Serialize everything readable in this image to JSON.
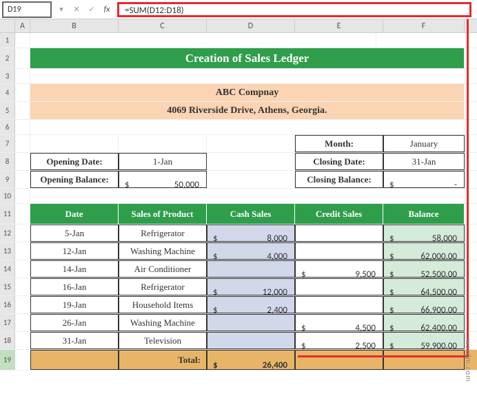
{
  "name_box": "D19",
  "formula": "=SUM(D12:D18)",
  "cols": {
    "A": "A",
    "B": "B",
    "C": "C",
    "D": "D",
    "E": "E",
    "F": "F"
  },
  "rows": [
    "1",
    "2",
    "3",
    "4",
    "5",
    "6",
    "7",
    "8",
    "9",
    "10",
    "11",
    "12",
    "13",
    "14",
    "15",
    "16",
    "17",
    "18",
    "19"
  ],
  "title": "Creation of Sales Ledger",
  "company_name": "ABC Compnay",
  "company_addr": "4069 Riverside Drive, Athens, Georgia.",
  "labels": {
    "month": "Month:",
    "opening_date": "Opening Date:",
    "closing_date": "Closing Date:",
    "opening_balance": "Opening Balance:",
    "closing_balance": "Closing Balance:",
    "total": "Total:"
  },
  "info": {
    "month_val": "January",
    "opening_date_val": "1-Jan",
    "closing_date_val": "31-Jan",
    "opening_balance_val": "50,000",
    "closing_balance_val": "-"
  },
  "headers": {
    "date": "Date",
    "product": "Sales of Product",
    "cash": "Cash Sales",
    "credit": "Credit Sales",
    "balance": "Balance"
  },
  "table": [
    {
      "date": "5-Jan",
      "product": "Refrigerator",
      "cash": "8,000",
      "credit": "",
      "balance": "58,000"
    },
    {
      "date": "12-Jan",
      "product": "Washing Machine",
      "cash": "4,000",
      "credit": "",
      "balance": "62,000.00"
    },
    {
      "date": "14-Jan",
      "product": "Air Conditioner",
      "cash": "",
      "credit": "9,500",
      "balance": "52,500.00"
    },
    {
      "date": "16-Jan",
      "product": "Refrigerator",
      "cash": "12,000",
      "credit": "",
      "balance": "64,500.00"
    },
    {
      "date": "19-Jan",
      "product": "Household Items",
      "cash": "2,400",
      "credit": "",
      "balance": "66,900.00"
    },
    {
      "date": "26-Jan",
      "product": "Washing Machine",
      "cash": "",
      "credit": "4,500",
      "balance": "62,400.00"
    },
    {
      "date": "31-Jan",
      "product": "Television",
      "cash": "",
      "credit": "2,500",
      "balance": "59,900.00"
    }
  ],
  "total_cash": "26,400",
  "watermark": "wsxdm.com",
  "chart_data": {
    "type": "table",
    "title": "Creation of Sales Ledger",
    "columns": [
      "Date",
      "Sales of Product",
      "Cash Sales",
      "Credit Sales",
      "Balance"
    ],
    "rows": [
      [
        "5-Jan",
        "Refrigerator",
        8000,
        null,
        58000
      ],
      [
        "12-Jan",
        "Washing Machine",
        4000,
        null,
        62000
      ],
      [
        "14-Jan",
        "Air Conditioner",
        null,
        9500,
        52500
      ],
      [
        "16-Jan",
        "Refrigerator",
        12000,
        null,
        64500
      ],
      [
        "19-Jan",
        "Household Items",
        2400,
        null,
        66900
      ],
      [
        "26-Jan",
        "Washing Machine",
        null,
        4500,
        62400
      ],
      [
        "31-Jan",
        "Television",
        null,
        2500,
        59900
      ]
    ],
    "totals": {
      "cash_sales": 26400
    },
    "opening_balance": 50000,
    "opening_date": "1-Jan",
    "closing_date": "31-Jan",
    "month": "January"
  }
}
